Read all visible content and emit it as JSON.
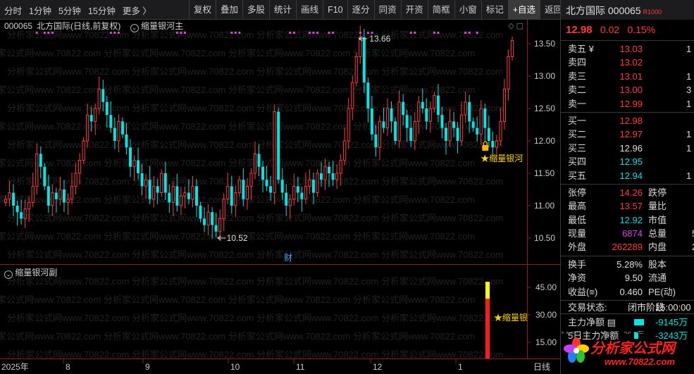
{
  "toolbar": {
    "periods": [
      "分时",
      "1分钟",
      "5分钟",
      "15分钟",
      "更多 〉"
    ],
    "tools": [
      "复权",
      "叠加",
      "多股",
      "统计",
      "画线",
      "F10",
      "逐分",
      "同资",
      "开资",
      "简框",
      "小窗",
      "标记",
      "+自选",
      "返回"
    ]
  },
  "main_chart": {
    "code": "000065",
    "title": "北方国际(日线,前复权)",
    "indicator": "缩量银河主",
    "high_label": "13.66",
    "low_label": "10.52",
    "signal_label": "★缩量银河",
    "finance_mark": "财",
    "y_ticks": [
      "13.50",
      "13.00",
      "12.50",
      "12.00",
      "11.50",
      "11.00",
      "10.50"
    ],
    "watermark": "分析家公式网www.70822.com",
    "colors": {
      "up": "#ff3b3b",
      "down": "#00e5e5",
      "signal_dot": "#e040e0"
    }
  },
  "sub_chart": {
    "indicator": "缩量银河副",
    "signal_label": "★缩量银",
    "y_ticks": [
      "45.00",
      "30.00",
      "15.00"
    ]
  },
  "date_axis": {
    "labels": [
      "2025年",
      "8",
      "9",
      "10",
      "11",
      "12",
      "1",
      "日线"
    ]
  },
  "chart_data": {
    "type": "candlestick",
    "title": "北方国际(日线,前复权)",
    "ylim": [
      10.3,
      13.75
    ],
    "y_ticks": [
      10.5,
      11.0,
      11.5,
      12.0,
      12.5,
      13.0,
      13.5
    ],
    "x_month_labels": [
      "2025年",
      "8",
      "9",
      "10",
      "11",
      "12",
      "1"
    ],
    "high": 13.66,
    "low": 10.52,
    "close": [
      11.1,
      11.2,
      11.0,
      10.9,
      10.8,
      10.95,
      11.05,
      11.3,
      11.8,
      11.6,
      11.3,
      11.0,
      11.2,
      11.1,
      11.25,
      11.05,
      11.1,
      11.3,
      11.5,
      11.7,
      12.0,
      12.4,
      12.3,
      12.5,
      12.8,
      12.6,
      12.4,
      12.2,
      12.0,
      12.3,
      12.1,
      11.9,
      11.6,
      11.7,
      11.5,
      11.3,
      11.4,
      11.1,
      11.3,
      11.2,
      11.5,
      11.2,
      11.05,
      11.3,
      11.0,
      11.15,
      11.2,
      11.1,
      11.3,
      11.0,
      10.8,
      10.7,
      10.9,
      10.7,
      10.6,
      10.8,
      11.1,
      11.3,
      11.0,
      11.2,
      11.4,
      11.1,
      11.3,
      11.5,
      11.8,
      11.6,
      11.4,
      11.3,
      11.2,
      12.45,
      11.4,
      11.2,
      11.0,
      11.1,
      11.3,
      11.2,
      11.1,
      11.3,
      11.4,
      11.2,
      11.5,
      11.4,
      11.6,
      11.5,
      11.4,
      11.5,
      11.7,
      12.0,
      12.5,
      12.9,
      13.3,
      13.6,
      12.9,
      12.5,
      12.1,
      11.9,
      12.3,
      12.2,
      12.5,
      12.3,
      12.0,
      12.6,
      12.4,
      12.2,
      12.0,
      12.3,
      12.6,
      12.5,
      12.3,
      12.5,
      12.7,
      12.4,
      12.2,
      12.0,
      12.3,
      12.2,
      12.0,
      12.4,
      12.6,
      12.3,
      12.2,
      12.1,
      12.5,
      12.2,
      12.0,
      11.9,
      12.0,
      12.3,
      12.8,
      13.3,
      13.55
    ]
  }
}
